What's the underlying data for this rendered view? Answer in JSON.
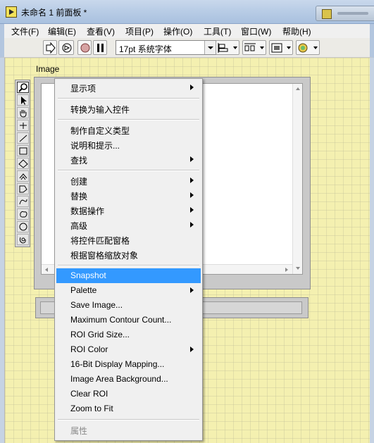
{
  "window": {
    "title": "未命名 1 前面板 *"
  },
  "menubar": {
    "items": [
      {
        "label": "文件(F)"
      },
      {
        "label": "编辑(E)"
      },
      {
        "label": "查看(V)"
      },
      {
        "label": "项目(P)"
      },
      {
        "label": "操作(O)"
      },
      {
        "label": "工具(T)"
      },
      {
        "label": "窗口(W)"
      },
      {
        "label": "帮助(H)"
      }
    ]
  },
  "toolbar": {
    "font_select": "17pt 系统字体"
  },
  "canvas": {
    "control_label": "Image"
  },
  "context_menu": {
    "items": [
      {
        "label": "显示项",
        "submenu": true
      },
      {
        "label": "转换为输入控件"
      },
      {
        "label": "制作自定义类型"
      },
      {
        "label": "说明和提示..."
      },
      {
        "label": "查找",
        "submenu": true
      },
      {
        "label": "创建",
        "submenu": true
      },
      {
        "label": "替换",
        "submenu": true
      },
      {
        "label": "数据操作",
        "submenu": true
      },
      {
        "label": "高级",
        "submenu": true
      },
      {
        "label": "将控件匹配窗格"
      },
      {
        "label": "根据窗格缩放对象"
      },
      {
        "label": "Snapshot",
        "highlighted": true
      },
      {
        "label": "Palette",
        "submenu": true
      },
      {
        "label": "Save Image..."
      },
      {
        "label": "Maximum Contour Count..."
      },
      {
        "label": "ROI Grid Size..."
      },
      {
        "label": "ROI Color",
        "submenu": true
      },
      {
        "label": "16-Bit Display Mapping..."
      },
      {
        "label": "Image Area Background..."
      },
      {
        "label": "Clear ROI"
      },
      {
        "label": "Zoom to Fit"
      },
      {
        "label": "属性",
        "disabled": true
      }
    ]
  },
  "colors": {
    "highlight": "#3399ff",
    "canvas": "#f4f0b0"
  }
}
